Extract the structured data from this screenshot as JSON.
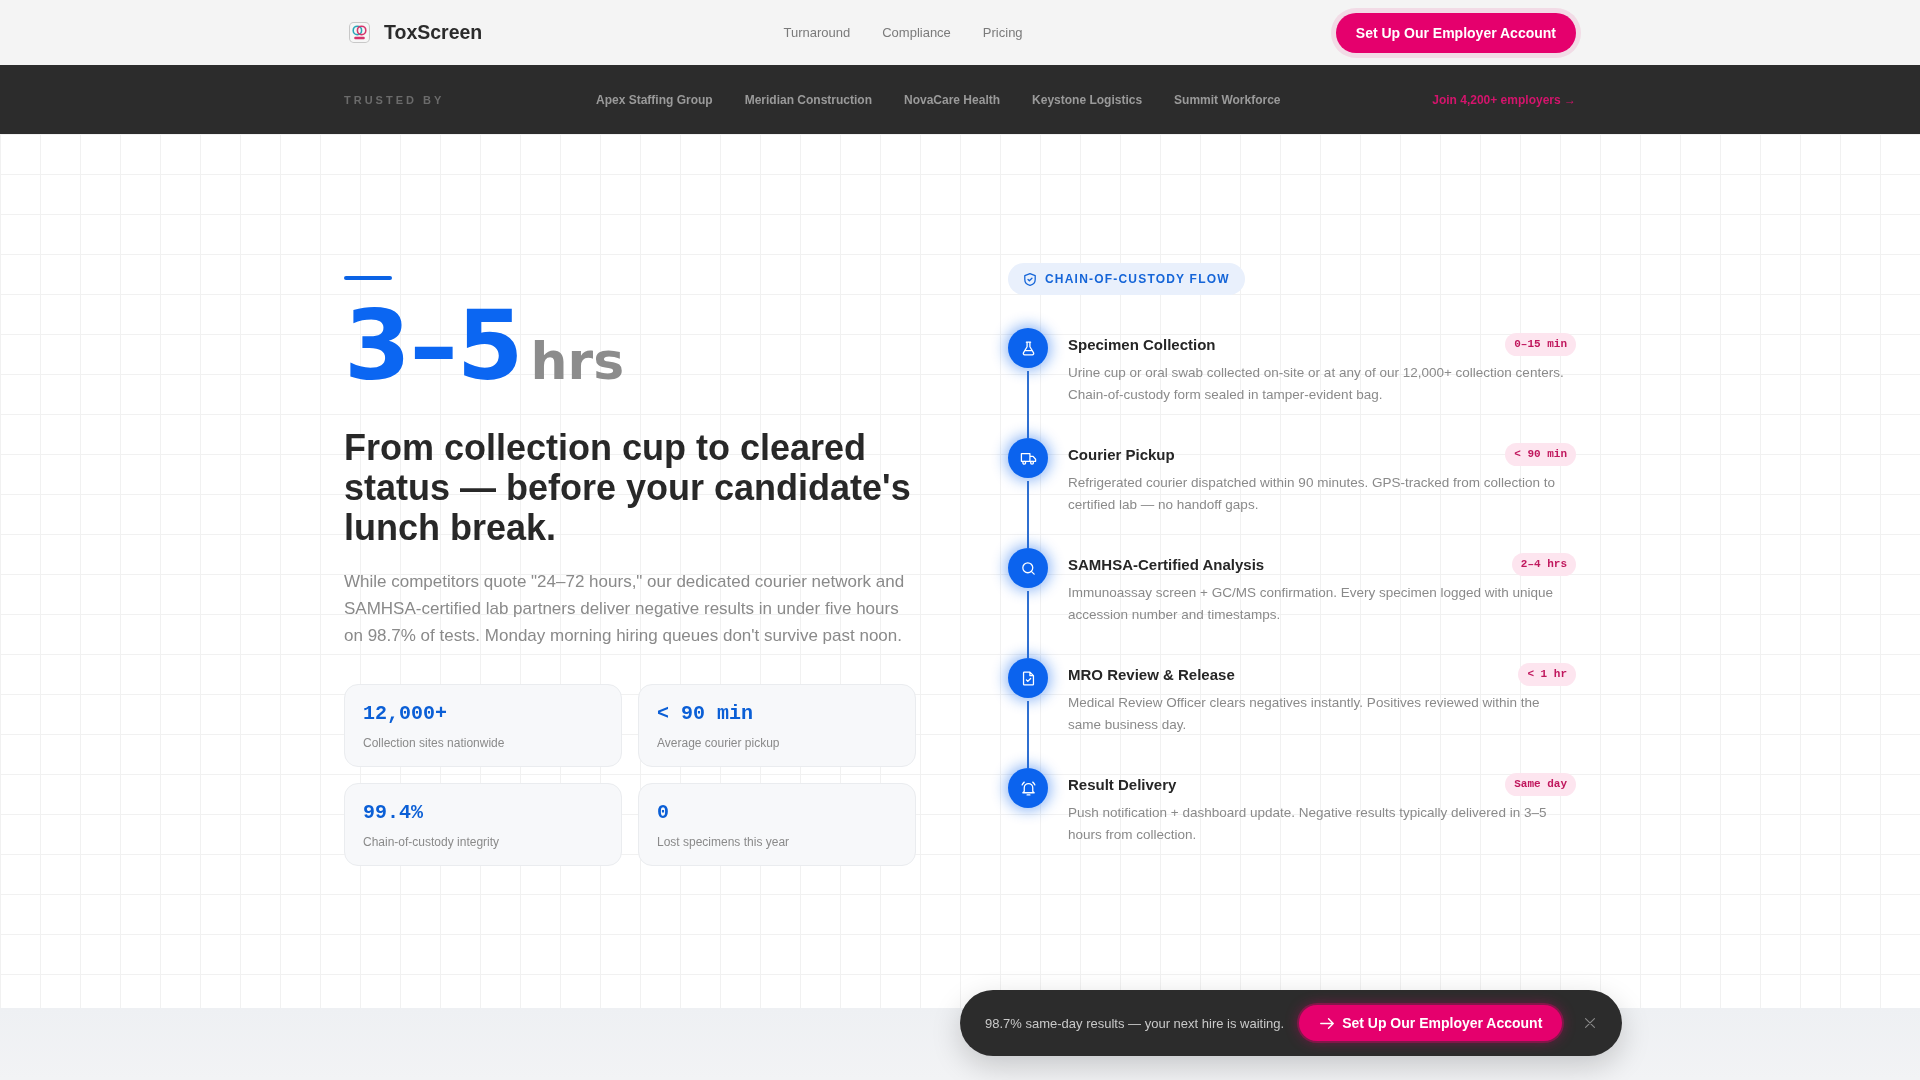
{
  "header": {
    "brand": "ToxScreen",
    "nav": [
      "Turnaround",
      "Compliance",
      "Pricing"
    ],
    "cta": "Set Up Our Employer Account"
  },
  "trusted_bar": {
    "label": "TRUSTED BY",
    "companies": [
      "Apex Staffing Group",
      "Meridian Construction",
      "NovaCare Health",
      "Keystone Logistics",
      "Summit Workforce"
    ],
    "link": "Join 4,200+ employers →"
  },
  "hero": {
    "figure": "3–5",
    "unit": "hrs",
    "headline": "From collection cup to cleared status — before your candidate's lunch break.",
    "body": "While competitors quote \"24–72 hours,\" our dedicated courier network and SAMHSA-certified lab partners deliver negative results in under five hours on 98.7% of tests. Monday morning hiring queues don't survive past noon.",
    "stats": [
      {
        "value": "12,000+",
        "label": "Collection sites nationwide"
      },
      {
        "value": "< 90 min",
        "label": "Average courier pickup"
      },
      {
        "value": "99.4%",
        "label": "Chain-of-custody integrity"
      },
      {
        "value": "0",
        "label": "Lost specimens this year"
      }
    ]
  },
  "flow": {
    "badge": "CHAIN-OF-CUSTODY FLOW",
    "steps": [
      {
        "title": "Specimen Collection",
        "duration": "0–15 min",
        "description": "Urine cup or oral swab collected on-site or at any of our 12,000+ collection centers. Chain-of-custody form sealed in tamper-evident bag."
      },
      {
        "title": "Courier Pickup",
        "duration": "< 90 min",
        "description": "Refrigerated courier dispatched within 90 minutes. GPS-tracked from collection to certified lab — no handoff gaps."
      },
      {
        "title": "SAMHSA-Certified Analysis",
        "duration": "2–4 hrs",
        "description": "Immunoassay screen + GC/MS confirmation. Every specimen logged with unique accession number and timestamps."
      },
      {
        "title": "MRO Review & Release",
        "duration": "< 1 hr",
        "description": "Medical Review Officer clears negatives instantly. Positives reviewed within the same business day."
      },
      {
        "title": "Result Delivery",
        "duration": "Same day",
        "description": "Push notification + dashboard update. Negative results typically delivered in 3–5 hours from collection."
      }
    ]
  },
  "sticky_banner": {
    "message": "98.7% same-day results — your next hire is waiting.",
    "cta": "Set Up Our Employer Account"
  }
}
